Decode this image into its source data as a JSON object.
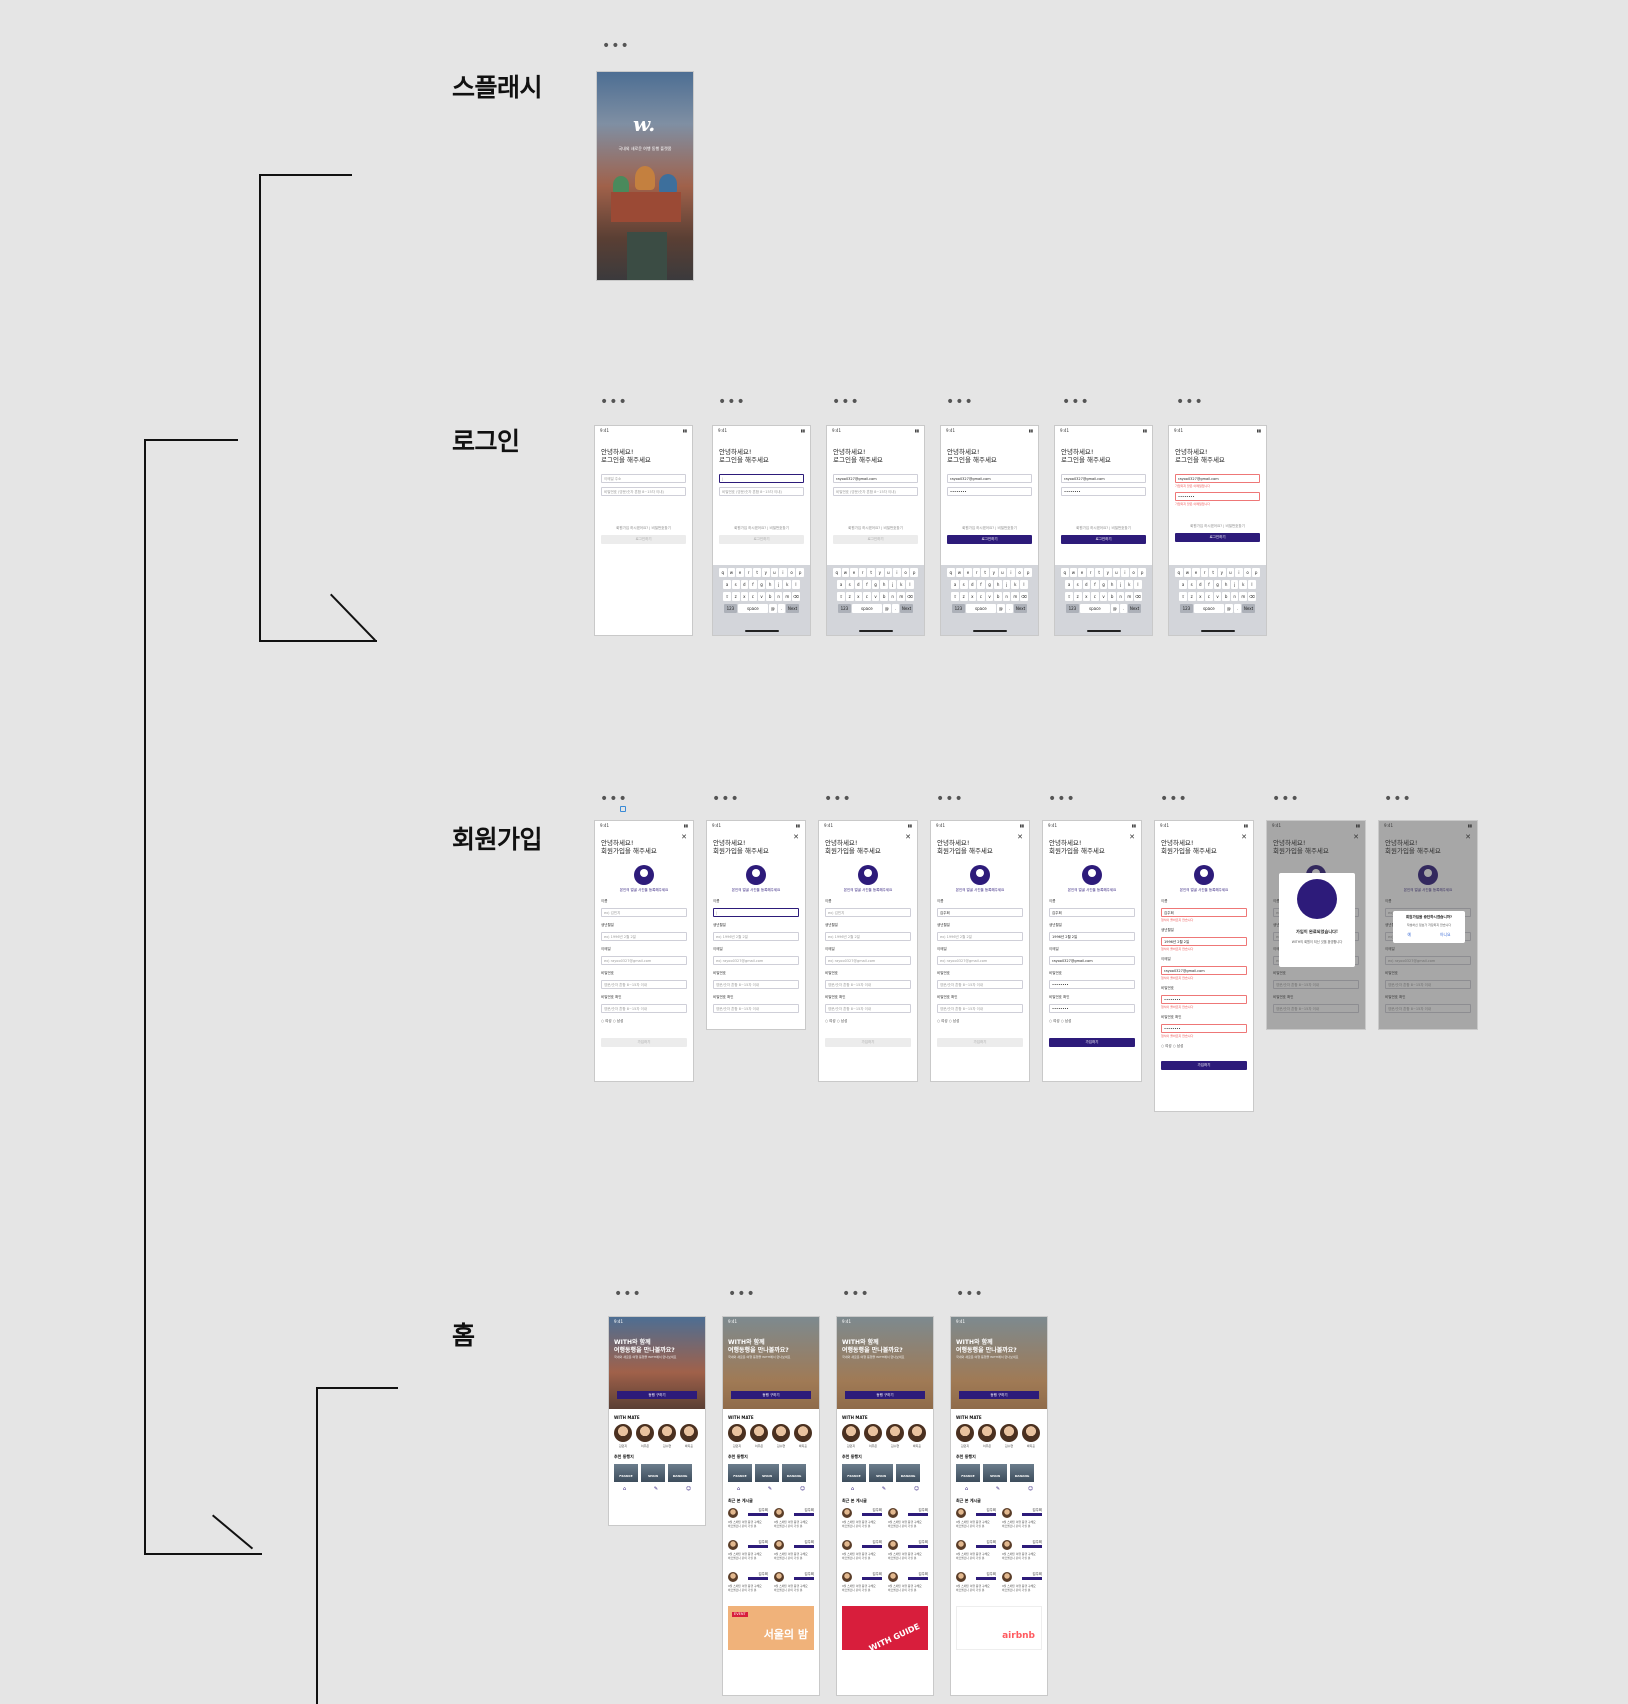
{
  "sections": {
    "splash": "스플래시",
    "login": "로그인",
    "signup": "회원가입",
    "home": "홈"
  },
  "more_dots": "•••",
  "signup_note": "",
  "splash": {
    "tagline": "국내외 새로운 여행 동행 플랫폼"
  },
  "login": {
    "time": "9:41",
    "greeting_1": "안녕하세요!",
    "greeting_2": "로그인을 해주세요",
    "email_placeholder": "이메일 주소",
    "password_placeholder": "비밀번호 (영문/숫자 혼합 8~15자 이내)",
    "email_value": "rayoo0327@gmail.com",
    "password_value": "••••••••",
    "error_text": "가입되지 않은 이메일입니다",
    "links": "회원가입 하시겠어요? | 비밀번호찾기",
    "login_button": "로그인하기",
    "kb_row1": [
      "q",
      "w",
      "e",
      "r",
      "t",
      "y",
      "u",
      "i",
      "o",
      "p"
    ],
    "kb_row2": [
      "a",
      "s",
      "d",
      "f",
      "g",
      "h",
      "j",
      "k",
      "l"
    ],
    "kb_row3": [
      "⇧",
      "z",
      "x",
      "c",
      "v",
      "b",
      "n",
      "m",
      "⌫"
    ],
    "kb_row4": [
      "123",
      "space",
      "@",
      ".",
      "Next"
    ]
  },
  "signup": {
    "greeting_1": "안녕하세요!",
    "greeting_2": "회원가입을 해주세요",
    "photo_hint": "본인의 얼굴 사진을 등록해주세요",
    "name_label": "이름",
    "name_placeholder": "ex) 김민지",
    "name_value": "김주희",
    "birth_label": "생년월일",
    "birth_placeholder": "ex) 1996년 2월 2일",
    "birth_value": "1996년 2월 2일",
    "email_label": "이메일",
    "email_placeholder": "ex) rayoo0327@gmail.com",
    "email_value": "rayoo0327@gmail.com",
    "pw_label": "비밀번호",
    "pw_placeholder": "영문/숫자 혼합 8~15자 이내",
    "pw2_label": "비밀번호 확인",
    "pw2_placeholder": "영문/숫자 혼합 8~15자 이내",
    "err_text": "형식이 올바르지 않습니다",
    "gender_f": "여성",
    "gender_m": "남성",
    "submit": "가입하기",
    "done_title": "가입이 완료되었습니다!",
    "done_sub": "WITH의 회원이 되신 것을 환영합니다",
    "quit_title": "회원가입을 중단하시겠습니까?",
    "quit_sub": "작성하신 정보가 저장되지 않습니다",
    "quit_yes": "예",
    "quit_no": "아니요"
  },
  "home": {
    "time": "9:41",
    "hero_title_1": "WITH와 함께",
    "hero_title_2": "여행동행을 만나볼까요?",
    "hero_sub": "국내외 새로운 여행 동행을 WITH에서 만나보세요",
    "hero_button": "동행 구하기",
    "mate_label": "WITH MATE",
    "mates": [
      "김민지",
      "이주은",
      "김수현",
      "박지훈"
    ],
    "rec_label": "추천 동행지",
    "recs": [
      "FRANCE",
      "SPAIN",
      "DANANG"
    ],
    "recent_label": "최근 본 게시글",
    "post_name": "김주희",
    "post_text": "9월 스페인 여행 동행 구해요 바르셀로나 같이 가실 분",
    "banner_1_tag": "EVENT",
    "banner_1_text": "서울의 밤",
    "banner_2_text": "WITH GUIDE",
    "banner_3_text": "airbnb"
  },
  "colors": {
    "primary": "#2d1b7a",
    "background": "#e5e5e5",
    "error": "#e55555"
  }
}
